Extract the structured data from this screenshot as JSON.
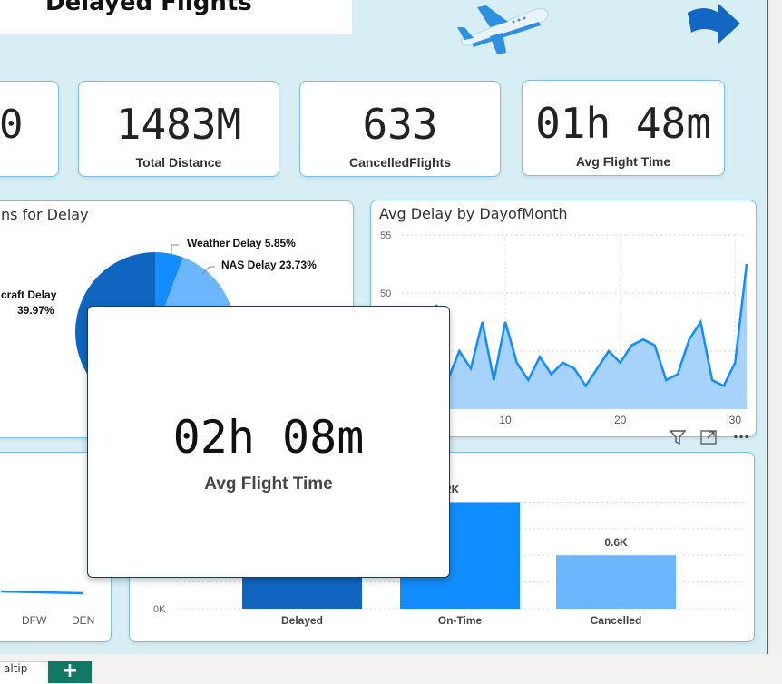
{
  "page": {
    "title": "Delayed Flights"
  },
  "kpis": [
    {
      "value": "0",
      "label": ""
    },
    {
      "value": "1483M",
      "label": "Total Distance"
    },
    {
      "value": "633",
      "label": "CancelledFlights"
    },
    {
      "value": "01h 48m",
      "label": "Avg Flight Time"
    }
  ],
  "delay_reasons": {
    "title": "Reasons for Delay",
    "title_visible": "ns for Delay",
    "labels": [
      {
        "name": "Weather Delay",
        "pct": "5.85%"
      },
      {
        "name": "NAS Delay",
        "pct": "23.73%"
      },
      {
        "name": "Aircraft Delay",
        "name_visible": "craft Delay",
        "pct": "39.97%"
      }
    ]
  },
  "chart_data": [
    {
      "type": "area",
      "title": "Avg Delay by DayofMonth",
      "x_ticks": [
        "10",
        "20",
        "30"
      ],
      "y_ticks": [
        "55",
        "50"
      ],
      "ylim": [
        40,
        55
      ],
      "x": [
        1,
        2,
        3,
        4,
        5,
        6,
        7,
        8,
        9,
        10,
        11,
        12,
        13,
        14,
        15,
        16,
        17,
        18,
        19,
        20,
        21,
        22,
        23,
        24,
        25,
        26,
        27,
        28,
        29,
        30,
        31
      ],
      "values": [
        49,
        42.5,
        45,
        43.5,
        47.5,
        42.5,
        47.5,
        44,
        42.5,
        44.5,
        43,
        44,
        43.5,
        42,
        43.5,
        45,
        44,
        45.5,
        46,
        45.5,
        42.5,
        43,
        46,
        47.5,
        42.5,
        42,
        44,
        52.5
      ]
    },
    {
      "type": "bar",
      "title": "",
      "categories": [
        "Delayed",
        "On-Time",
        "Cancelled"
      ],
      "values": [
        1.2,
        1.2,
        0.6
      ],
      "data_labels": [
        "",
        ".2K",
        "0.6K"
      ],
      "y_ticks": [
        "0K"
      ]
    }
  ],
  "airport_chart": {
    "x_ticks": [
      "DFW",
      "DEN"
    ]
  },
  "tooltip": {
    "value": "02h 08m",
    "label": "Avg Flight Time"
  },
  "visual_header": {
    "filter_icon": "filter-icon",
    "focus_icon": "focus-mode-icon",
    "more_icon": "more-options-icon",
    "more_label": "···"
  },
  "tabs": {
    "active_visible": "altip",
    "add_label": "+"
  },
  "colors": {
    "accent": "#118dff",
    "dark_blue": "#1065c0",
    "light_blue": "#6cb6ff",
    "area_fill": "#a6d2fb",
    "canvas": "#d6eef4",
    "add_tab": "#117865"
  }
}
